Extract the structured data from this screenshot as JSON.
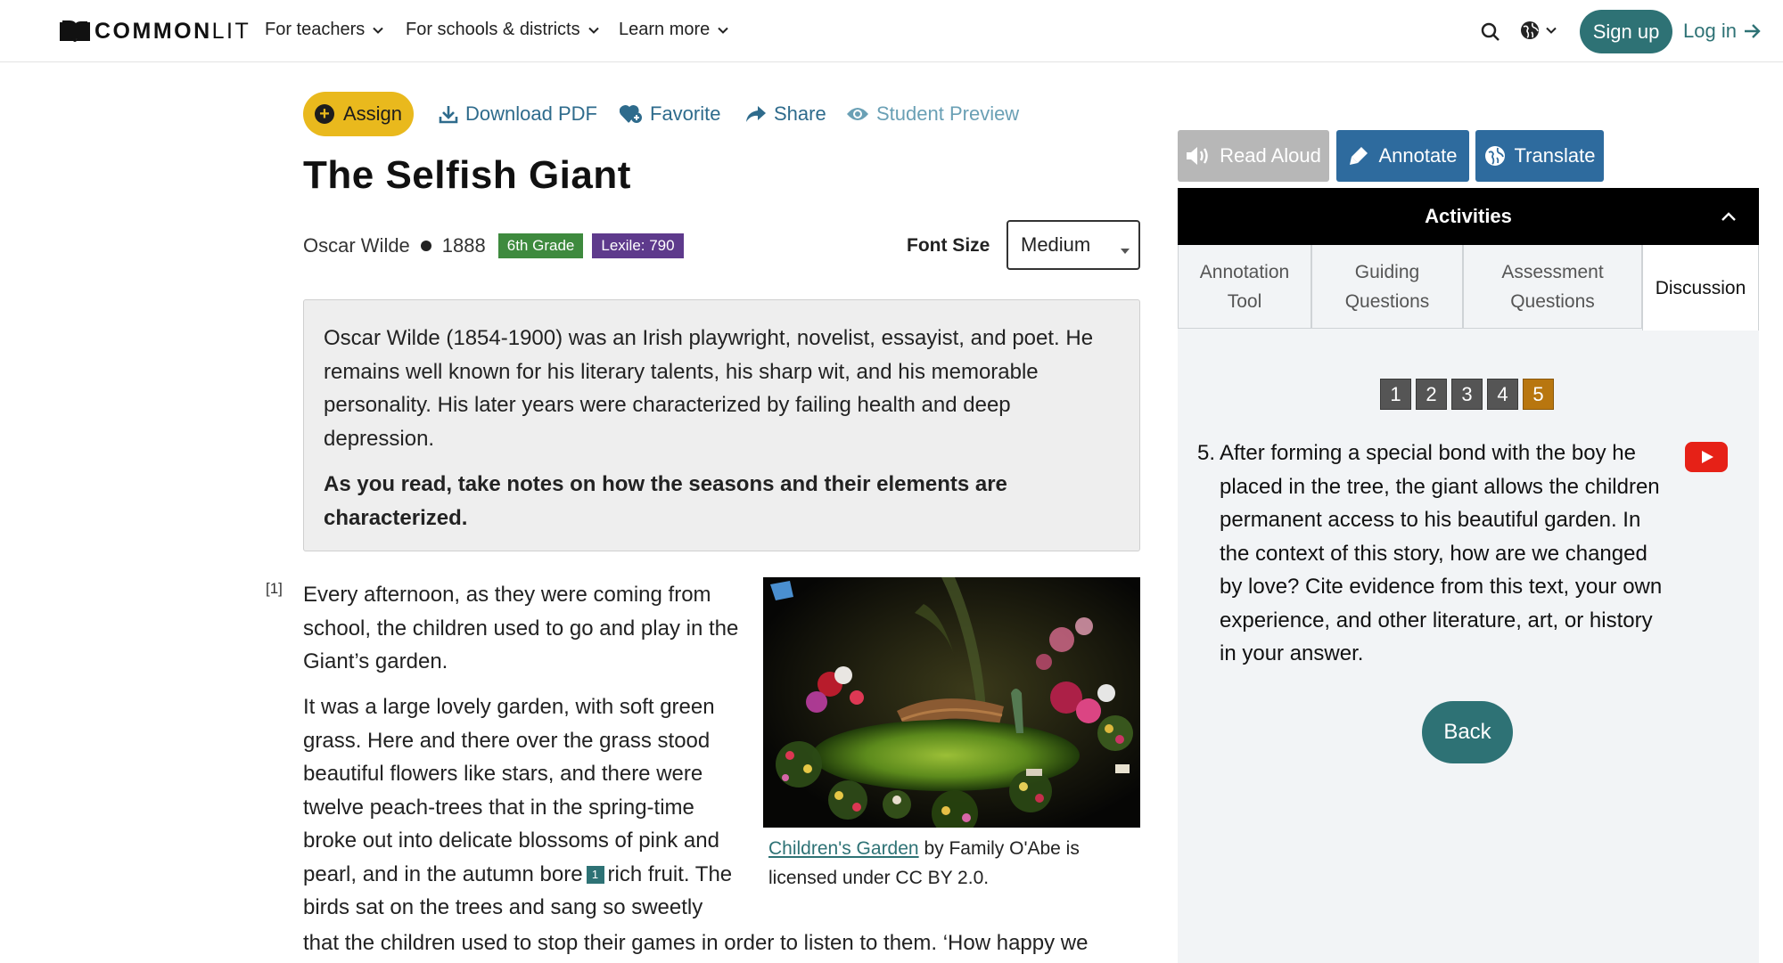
{
  "nav": {
    "logo_bold": "COMMON",
    "logo_light": "LIT",
    "items": [
      "For teachers",
      "For schools & districts",
      "Learn more"
    ],
    "signup": "Sign up",
    "login": "Log in"
  },
  "actions": {
    "assign": "Assign",
    "download": "Download PDF",
    "favorite": "Favorite",
    "share": "Share",
    "preview": "Student Preview"
  },
  "text": {
    "title": "The Selfish Giant",
    "author": "Oscar Wilde",
    "year": "1888",
    "grade": "6th Grade",
    "lexile": "Lexile: 790",
    "font_size_label": "Font Size",
    "font_size_value": "Medium",
    "intro": "Oscar Wilde (1854-1900) was an Irish playwright, novelist, essayist, and poet. He remains well known for his literary talents, his sharp wit, and his memorable personality. His later years were characterized by failing health and deep depression.",
    "intro_prompt": "As you read, take notes on how the seasons and their elements are characterized.",
    "para_number": "[1]",
    "para1": "Every afternoon, as they were coming from school, the children used to go and play in the Giant’s garden.",
    "para2_before": "It was a large lovely garden, with soft green grass. Here and there over the grass stood beautiful flowers like stars, and there were twelve peach-trees that in the spring-time broke out into delicate blossoms of pink and pearl, and in the autumn bore",
    "footnote": "1",
    "para2_after": "rich fruit. The birds sat on the trees and sang so sweetly",
    "para2_wide": "that the children used to stop their games in order to listen to them. ‘How happy we",
    "caption_link": "Children's Garden",
    "caption_rest": " by Family O'Abe is licensed under CC BY 2.0."
  },
  "panel": {
    "read_aloud": "Read Aloud",
    "annotate": "Annotate",
    "translate": "Translate",
    "activities": "Activities",
    "tabs": [
      "Annotation Tool",
      "Guiding Questions",
      "Assessment Questions",
      "Discussion"
    ],
    "active_tab": "Discussion",
    "pages": [
      "1",
      "2",
      "3",
      "4",
      "5"
    ],
    "active_page": "5",
    "question_number": "5.",
    "question": "After forming a special bond with the boy he placed in the tree, the giant allows the children permanent access to his beautiful garden. In the context of this story, how are we changed by love? Cite evidence from this text, your own experience, and other literature, art, or history in your answer.",
    "back": "Back"
  },
  "colors": {
    "teal": "#2e7275",
    "assign_yellow": "#e9b91d",
    "tool_blue": "#2e6b9e",
    "grade_green": "#3e8a3e",
    "lexile_purple": "#5e3a8c",
    "active_page": "#b8760f"
  }
}
